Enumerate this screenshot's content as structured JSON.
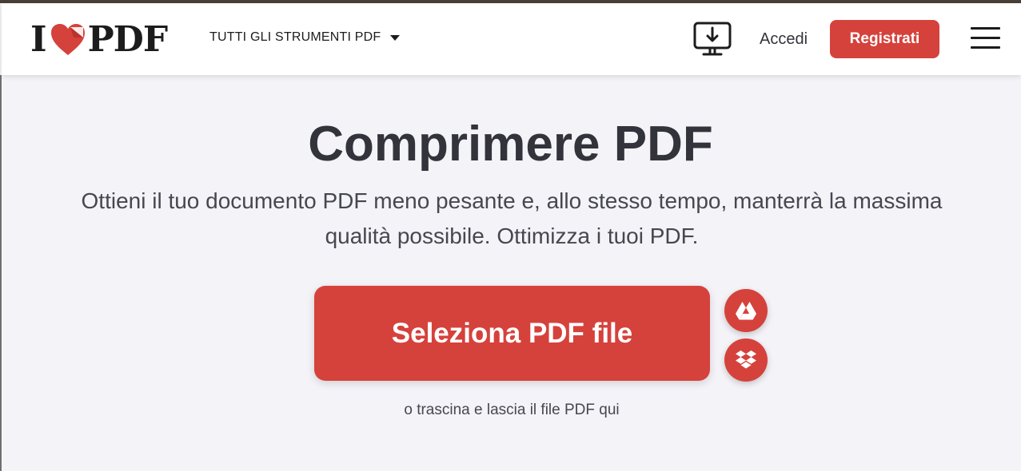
{
  "header": {
    "logo": {
      "left": "I",
      "right": "PDF",
      "icon": "heart-icon"
    },
    "tools_menu_label": "TUTTI GLI STRUMENTI PDF",
    "desktop_icon": "desktop-download-icon",
    "login_label": "Accedi",
    "register_label": "Registrati",
    "menu_icon": "hamburger-menu-icon"
  },
  "main": {
    "title": "Comprimere PDF",
    "subtitle": "Ottieni il tuo documento PDF meno pesante e, allo stesso tempo, manterrà la massima qualità possibile. Ottimizza i tuoi PDF.",
    "select_button_label": "Seleziona PDF file",
    "drop_hint": "o trascina e lascia il file PDF qui",
    "cloud_buttons": [
      {
        "icon": "google-drive-icon"
      },
      {
        "icon": "dropbox-icon"
      }
    ]
  },
  "colors": {
    "brand_red": "#d5423b",
    "text_dark": "#33333b",
    "page_bg": "#f4f3f8"
  }
}
